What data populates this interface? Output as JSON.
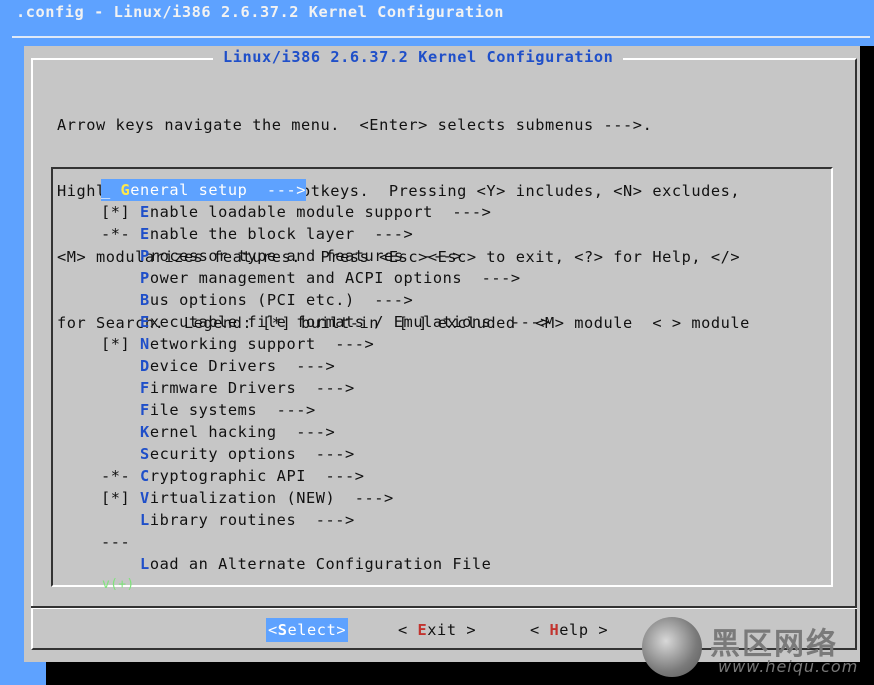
{
  "window": {
    "title": ".config - Linux/i386 2.6.37.2 Kernel Configuration"
  },
  "dialog": {
    "title": "Linux/i386 2.6.37.2 Kernel Configuration",
    "help_lines": [
      "Arrow keys navigate the menu.  <Enter> selects submenus --->.",
      "Highlighted letters are hotkeys.  Pressing <Y> includes, <N> excludes,",
      "<M> modularizes features.  Press <Esc><Esc> to exit, <?> for Help, </>",
      "for Search.  Legend: [*] built-in  [ ] excluded  <M> module  < > module"
    ]
  },
  "menu": {
    "items": [
      {
        "prefix": "_ ",
        "hot": "G",
        "rest": "eneral setup  --->",
        "selected": true
      },
      {
        "prefix": "[*] ",
        "hot": "E",
        "rest": "nable loadable module support  --->"
      },
      {
        "prefix": "-*- ",
        "hot": "E",
        "rest": "nable the block layer  --->"
      },
      {
        "prefix": "    ",
        "hot": "P",
        "rest": "rocessor type and features  --->"
      },
      {
        "prefix": "    ",
        "hot": "P",
        "rest": "ower management and ACPI options  --->"
      },
      {
        "prefix": "    ",
        "hot": "B",
        "rest": "us options (PCI etc.)  --->"
      },
      {
        "prefix": "    ",
        "hot": "E",
        "rest": "xecutable file formats / Emulations  --->"
      },
      {
        "prefix": "[*] ",
        "hot": "N",
        "rest": "etworking support  --->"
      },
      {
        "prefix": "    ",
        "hot": "D",
        "rest": "evice Drivers  --->"
      },
      {
        "prefix": "    ",
        "hot": "F",
        "rest": "irmware Drivers  --->"
      },
      {
        "prefix": "    ",
        "hot": "F",
        "rest": "ile systems  --->"
      },
      {
        "prefix": "    ",
        "hot": "K",
        "rest": "ernel hacking  --->"
      },
      {
        "prefix": "    ",
        "hot": "S",
        "rest": "ecurity options  --->"
      },
      {
        "prefix": "-*- ",
        "hot": "C",
        "rest": "ryptographic API  --->"
      },
      {
        "prefix": "[*] ",
        "hot": "V",
        "rest": "irtualization (NEW)  --->"
      },
      {
        "prefix": "    ",
        "hot": "L",
        "rest": "ibrary routines  --->"
      },
      {
        "prefix": "---",
        "hot": "",
        "rest": ""
      },
      {
        "prefix": "    ",
        "hot": "L",
        "rest": "oad an Alternate Configuration File"
      }
    ],
    "scroll_indicator": "v(+)"
  },
  "buttons": {
    "select": {
      "pre": "<",
      "hot": "S",
      "post": "elect>"
    },
    "exit": {
      "pre": "< ",
      "hot": "E",
      "post": "xit >"
    },
    "help": {
      "pre": "< ",
      "hot": "H",
      "post": "elp >"
    }
  },
  "watermark": {
    "text": "黑区网络",
    "url": "www.heiqu.com"
  },
  "colors": {
    "terminal_bg": "#5ea2ff",
    "dialog_bg": "#c6c6c6",
    "hotkey": "#1f4fc9",
    "selection_bg": "#5ea2ff"
  }
}
